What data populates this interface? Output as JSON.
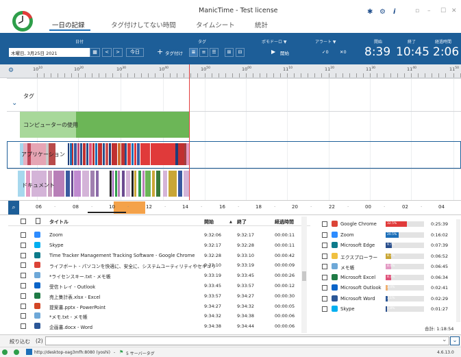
{
  "window": {
    "title": "ManicTime - Test license",
    "tabs": [
      "一日の記録",
      "タグ付けしてない時間",
      "タイムシート",
      "統計"
    ],
    "active_tab": 0,
    "icons": [
      "pin-icon",
      "gear-icon",
      "info-icon",
      "layout-icon",
      "minimize-icon",
      "maximize-icon",
      "close-icon"
    ],
    "window_controls": [
      "▫",
      "–",
      "☐",
      "✕"
    ],
    "info_glyph": "i"
  },
  "toolbar": {
    "date_section": "日付",
    "date_value": "木曜日, 3月25日 2021",
    "calendar_glyph": "▦",
    "prev_glyph": "<",
    "next_glyph": ">",
    "today_label": "今日",
    "tag_section": "タグ",
    "tag_add_label": "タグ付け",
    "pomodoro_section": "ポモドーロ ▼",
    "pomodoro_start": "開始",
    "alert_section": "アラート ▼",
    "alert_check": "✓0",
    "alert_x": "✕0",
    "start_label": "開始",
    "end_label": "終了",
    "elapsed_label": "経過時間",
    "start_time": "8:39",
    "end_time": "10:45",
    "elapsed_time": "2:06"
  },
  "ruler": {
    "ticks": [
      "10",
      "10",
      "10",
      "10",
      "10",
      "10",
      "11",
      "11",
      "11",
      "11",
      "11",
      "11"
    ],
    "tick_sup": [
      "10",
      "20",
      "30",
      "40",
      "50",
      "00",
      "10",
      "20",
      "30",
      "40",
      "50"
    ]
  },
  "timeline": {
    "tags_label": "タグ",
    "computer_label": "コンピューターの使用",
    "apps_label": "アプリケーション",
    "docs_label": "ドキュメント",
    "chevron": "⌄"
  },
  "overview": {
    "hours": [
      "06",
      "08",
      "10",
      "12",
      "14",
      "16",
      "18",
      "20",
      "22",
      "00",
      "02",
      "04"
    ]
  },
  "table": {
    "headers": {
      "title": "タイトル",
      "start": "開始",
      "end": "終了",
      "duration": "経過時間",
      "sort_glyph": "▲"
    },
    "rows": [
      {
        "icon": "zoom-icon",
        "color": "#2d8cff",
        "title": "Zoom",
        "start": "9:32:06",
        "end": "9:32:17",
        "dur": "00:00:11"
      },
      {
        "icon": "skype-icon",
        "color": "#00aff0",
        "title": "Skype",
        "start": "9:32:17",
        "end": "9:32:28",
        "dur": "00:00:11"
      },
      {
        "icon": "edge-icon",
        "color": "#0c7a8a",
        "title": "Time Tracker Management Tracking Software - Google Chrome",
        "start": "9:32:28",
        "end": "9:33:10",
        "dur": "00:00:42"
      },
      {
        "icon": "chrome-icon",
        "color": "#db4437",
        "title": "ライフボート - パソコンを快適に、安全に、システムユーティリティやセキュリ",
        "start": "9:33:10",
        "end": "9:33:19",
        "dur": "00:00:09"
      },
      {
        "icon": "notepad-icon",
        "color": "#6ea8d8",
        "title": "*ライセンスキー.txt - メモ帳",
        "start": "9:33:19",
        "end": "9:33:45",
        "dur": "00:00:26"
      },
      {
        "icon": "outlook-icon",
        "color": "#0a64c8",
        "title": "受信トレイ - Outlook",
        "start": "9:33:45",
        "end": "9:33:57",
        "dur": "00:00:12"
      },
      {
        "icon": "excel-icon",
        "color": "#1f7a45",
        "title": "売上集計表.xlsx - Excel",
        "start": "9:33:57",
        "end": "9:34:27",
        "dur": "00:00:30"
      },
      {
        "icon": "powerpoint-icon",
        "color": "#d24726",
        "title": "提案書.pptx - PowerPoint",
        "start": "9:34:27",
        "end": "9:34:32",
        "dur": "00:00:05"
      },
      {
        "icon": "notepad-icon",
        "color": "#6ea8d8",
        "title": "*メモ.txt - メモ帳",
        "start": "9:34:32",
        "end": "9:34:38",
        "dur": "00:00:06"
      },
      {
        "icon": "word-icon",
        "color": "#2b5797",
        "title": "企画書.docx - Word",
        "start": "9:34:38",
        "end": "9:34:44",
        "dur": "00:00:06"
      }
    ]
  },
  "side": {
    "rows": [
      {
        "icon": "chrome-icon",
        "color": "#db4437",
        "name": "Google Chrome",
        "pct": "32.5%",
        "frac": 0.325,
        "bar": "#e03a3a",
        "dur": "0:25:39"
      },
      {
        "icon": "zoom-icon",
        "color": "#2d8cff",
        "name": "Zoom",
        "pct": "20.5%",
        "frac": 0.205,
        "bar": "#1d6fb8",
        "dur": "0:16:02"
      },
      {
        "icon": "edge-icon",
        "color": "#0c7a8a",
        "name": "Microsoft Edge",
        "pct": "9.7%",
        "frac": 0.097,
        "bar": "#2a4f8c",
        "dur": "0:07:39"
      },
      {
        "icon": "folder-icon",
        "color": "#f0c040",
        "name": "エクスプローラー",
        "pct": "8.7%",
        "frac": 0.087,
        "bar": "#c9a636",
        "dur": "0:06:52"
      },
      {
        "icon": "notepad-icon",
        "color": "#6ea8d8",
        "name": "メモ帳",
        "pct": "8.6%",
        "frac": 0.086,
        "bar": "#e39ac4",
        "dur": "0:06:45"
      },
      {
        "icon": "excel-icon",
        "color": "#1f7a45",
        "name": "Microsoft Excel",
        "pct": "8.3%",
        "frac": 0.083,
        "bar": "#e0527a",
        "dur": "0:06:34"
      },
      {
        "icon": "outlook-icon",
        "color": "#0a64c8",
        "name": "Microsoft Outlook",
        "pct": "3.4%",
        "frac": 0.034,
        "bar": "#f0b070",
        "dur": "0:02:41"
      },
      {
        "icon": "word-icon",
        "color": "#2b5797",
        "name": "Microsoft Word",
        "pct": "3.1%",
        "frac": 0.031,
        "bar": "#2b5797",
        "dur": "0:02:29"
      },
      {
        "icon": "skype-icon",
        "color": "#00aff0",
        "name": "Skype",
        "pct": "1.8%",
        "frac": 0.018,
        "bar": "#2a4f8c",
        "dur": "0:01:27"
      }
    ],
    "total_label": "合計:",
    "total": "1:18:54"
  },
  "filter": {
    "label": "絞り込む",
    "count": "(2)",
    "dropdown_glyph": "⌄"
  },
  "status": {
    "server": "http://desktop-oag3mfh:8080 (yoshi)",
    "server_tag": "5 サーバータグ",
    "separator": "-",
    "version": "4.6.13.0"
  }
}
